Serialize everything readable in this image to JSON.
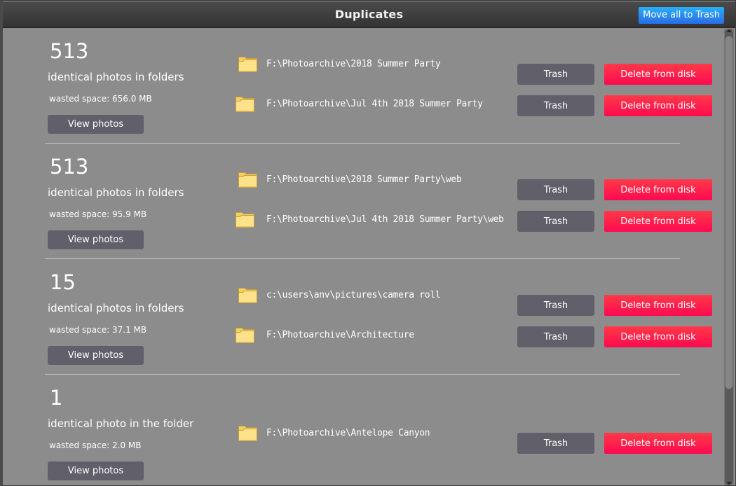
{
  "window": {
    "title": "Duplicates",
    "move_all_label": "Move all to Trash"
  },
  "colors": {
    "accent_blue": "#2b8cf0",
    "delete_red": "#ff1a4c",
    "button_gray": "#615f69",
    "background": "#8c8c8c"
  },
  "buttons": {
    "view_photos": "View photos",
    "trash": "Trash",
    "delete": "Delete from disk"
  },
  "groups": [
    {
      "count": "513",
      "description": "identical photos in folders",
      "wasted": "wasted space: 656.0 MB",
      "folders": [
        "F:\\Photoarchive\\2018 Summer Party",
        "F:\\Photoarchive\\Jul 4th 2018 Summer Party"
      ]
    },
    {
      "count": "513",
      "description": "identical photos in folders",
      "wasted": "wasted space: 95.9 MB",
      "folders": [
        "F:\\Photoarchive\\2018 Summer Party\\web",
        "F:\\Photoarchive\\Jul 4th 2018 Summer Party\\web"
      ]
    },
    {
      "count": "15",
      "description": "identical photos in folders",
      "wasted": "wasted space: 37.1 MB",
      "folders": [
        "c:\\users\\anv\\pictures\\camera roll",
        "F:\\Photoarchive\\Architecture"
      ]
    },
    {
      "count": "1",
      "description": "identical photo in the folder",
      "wasted": "wasted space: 2.0 MB",
      "folders": [
        "F:\\Photoarchive\\Antelope Canyon"
      ]
    }
  ]
}
